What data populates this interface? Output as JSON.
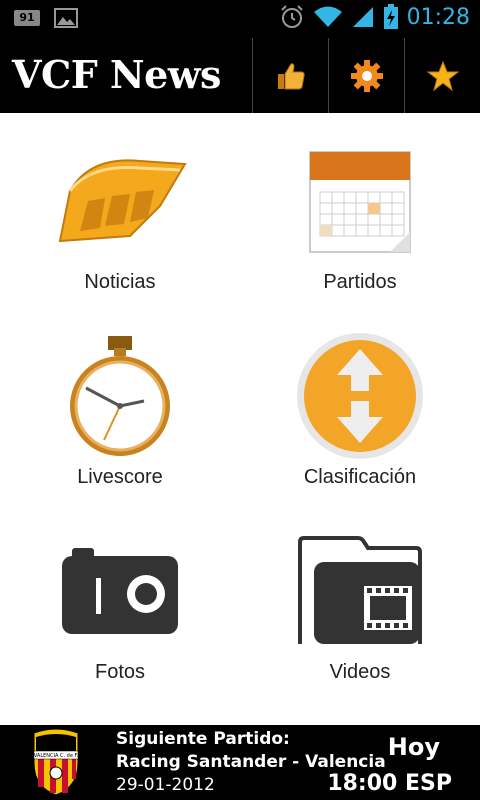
{
  "status_bar": {
    "notification_badge": "91",
    "time": "01:28",
    "icons": [
      "image-icon",
      "alarm-icon",
      "wifi-icon",
      "signal-icon",
      "battery-charging-icon"
    ],
    "accent_color": "#33b5e5"
  },
  "action_bar": {
    "title": "VCF News",
    "buttons": [
      "thumbs-up-icon",
      "settings-gear-icon",
      "favorite-star-icon"
    ]
  },
  "menu": [
    {
      "label": "Noticias",
      "icon": "news-stadium-icon"
    },
    {
      "label": "Partidos",
      "icon": "calendar-icon"
    },
    {
      "label": "Livescore",
      "icon": "stopwatch-icon"
    },
    {
      "label": "Clasificación",
      "icon": "sort-arrows-icon"
    },
    {
      "label": "Fotos",
      "icon": "camera-icon"
    },
    {
      "label": "Videos",
      "icon": "video-folder-icon"
    }
  ],
  "footer": {
    "heading": "Siguiente Partido:",
    "match": "Racing Santander - Valencia",
    "date": "29-01-2012",
    "day": "Hoy",
    "time": "18:00 ESP",
    "crest_label": "VALENCIA C. de F."
  }
}
